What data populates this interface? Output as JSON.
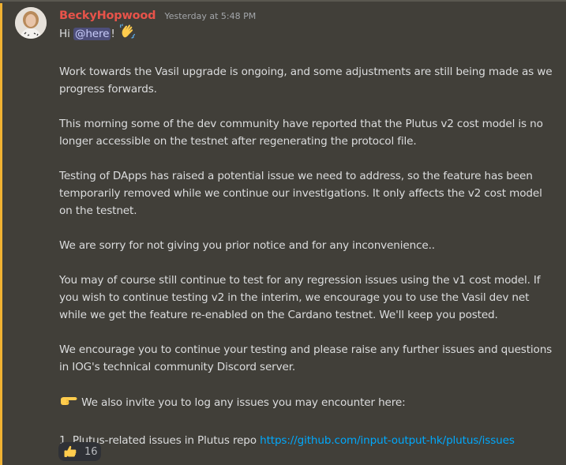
{
  "message": {
    "author": "BeckyHopwood",
    "timestamp": "Yesterday at 5:48 PM",
    "avatar_icon": "user-avatar-photo",
    "colors": {
      "author": "#e8534a",
      "mention_bar": "#f0b232",
      "link": "#00a8fc",
      "background": "#413f39"
    },
    "greeting_prefix": "Hi ",
    "mention": "@here",
    "greeting_suffix": "!",
    "greeting_emoji": "waving-hand-emoji",
    "paragraphs": [
      "Work towards the Vasil upgrade is ongoing, and some adjustments are still being made as we progress forwards.",
      "This morning some of the dev community have reported that the Plutus v2 cost model is no longer accessible on the testnet after regenerating the protocol file.",
      "Testing of DApps has raised a potential issue we need to address, so the feature has been temporarily removed while we continue our investigations. It only affects the v2 cost model on the testnet.",
      "We are sorry for not giving you prior notice and for any inconvenience..",
      "You may of course still continue to test for any regression issues using the v1 cost model. If you wish to continue testing v2 in the interim, we encourage you to use the Vasil dev net while we get the feature re-enabled on the Cardano testnet. We'll keep you posted.",
      "We encourage you to continue your testing and please raise any further issues and questions in IOG's technical community Discord server."
    ],
    "invite_emoji": "pointing-right-emoji",
    "invite_text": " We also invite you to log any issues you may encounter here:",
    "list_item_text": "1. Plutus-related issues in Plutus repo ",
    "list_item_link": "https://github.com/input-output-hk/plutus/issues"
  },
  "reaction": {
    "emoji": "thumbs-up-emoji",
    "count": "16"
  }
}
